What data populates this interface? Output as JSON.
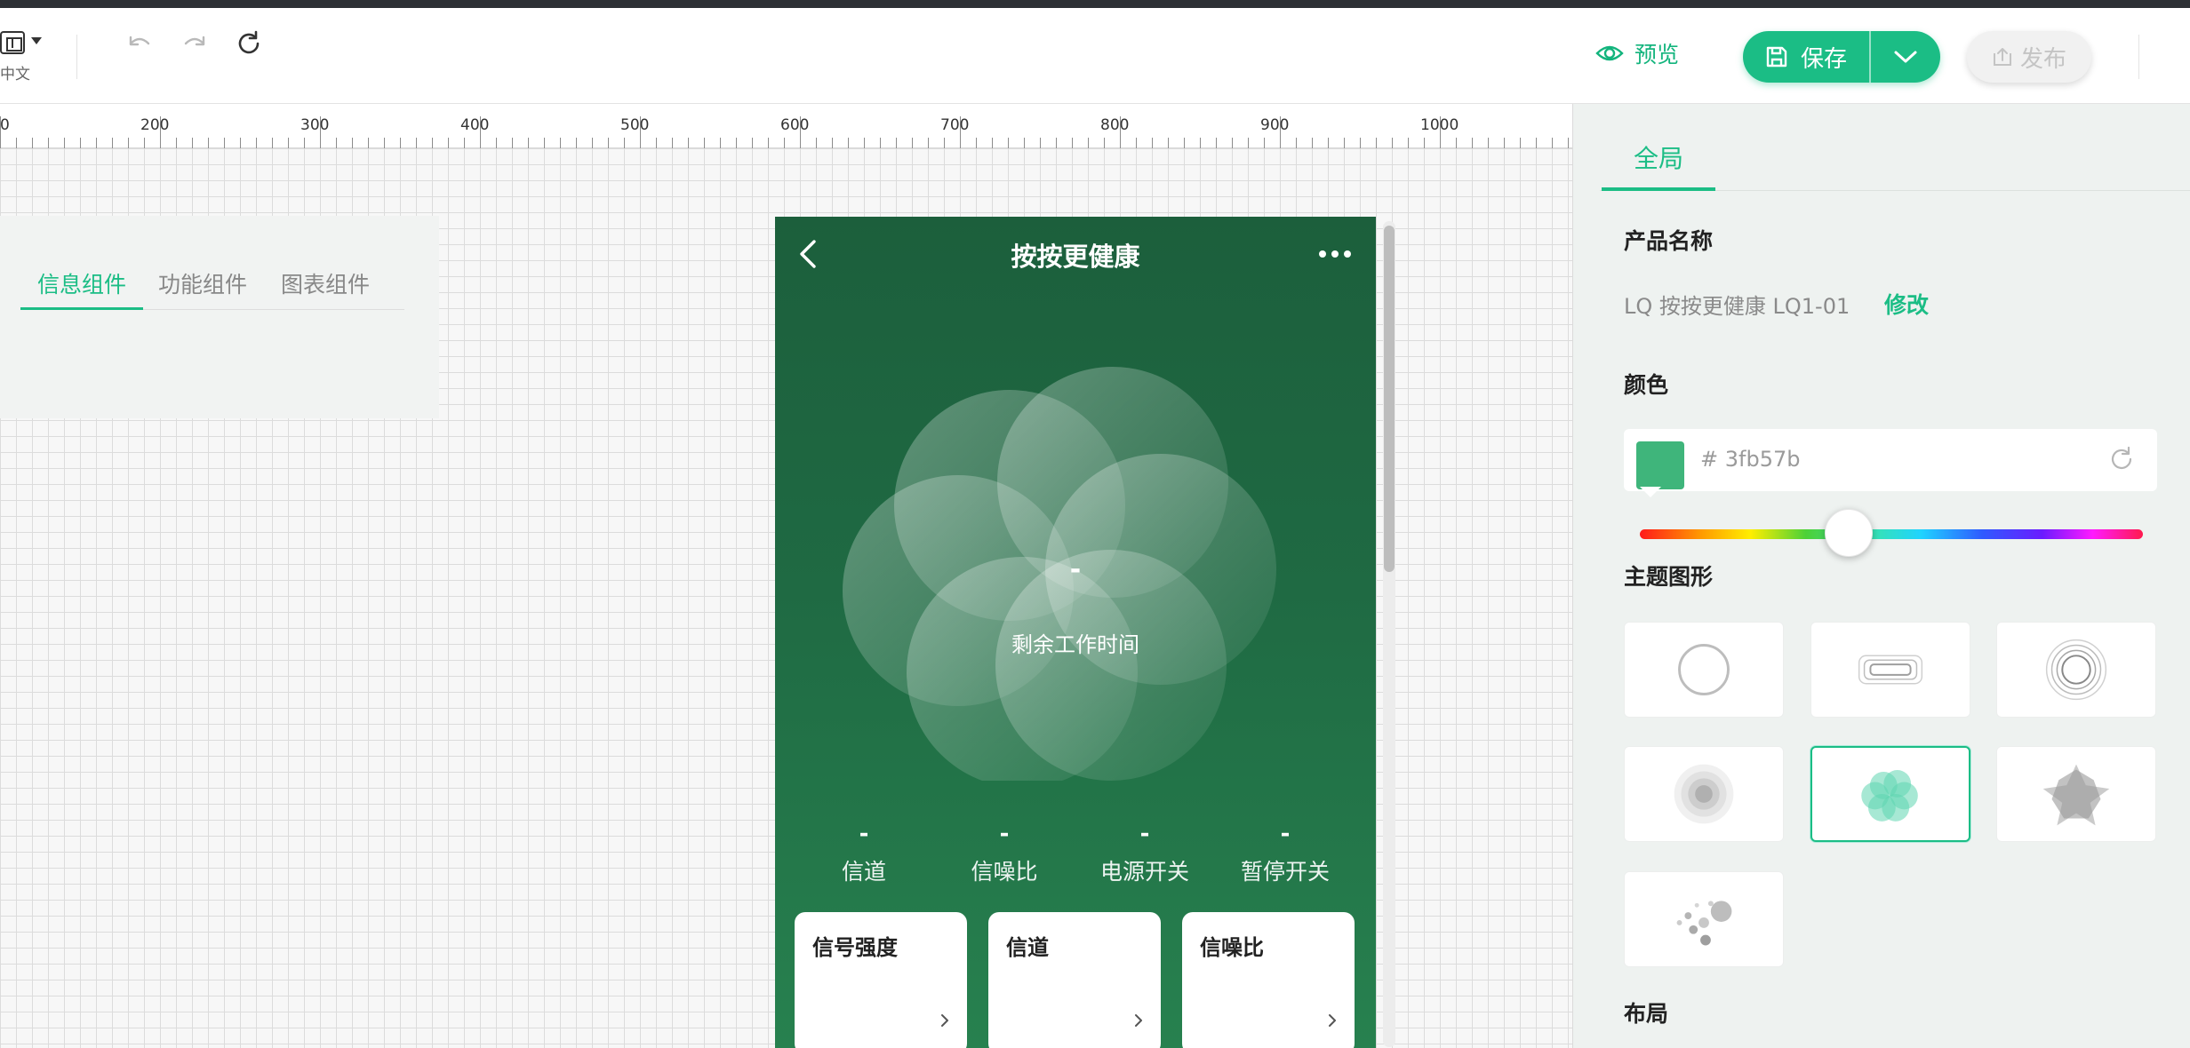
{
  "toolbar": {
    "language": "中文",
    "preview_label": "预览",
    "save_label": "保存",
    "publish_label": "发布"
  },
  "ruler": {
    "marks": [
      "0",
      "200",
      "300",
      "400",
      "500",
      "600",
      "700",
      "800",
      "900",
      "1000"
    ]
  },
  "component_panel": {
    "tabs": [
      {
        "label": "信息组件",
        "active": true
      },
      {
        "label": "功能组件",
        "active": false
      },
      {
        "label": "图表组件",
        "active": false
      }
    ]
  },
  "phone": {
    "title": "按按更健康",
    "remaining_time_value": "-",
    "remaining_time_label": "剩余工作时间",
    "stats": [
      {
        "value": "-",
        "label": "信道"
      },
      {
        "value": "-",
        "label": "信噪比"
      },
      {
        "value": "-",
        "label": "电源开关"
      },
      {
        "value": "-",
        "label": "暂停开关"
      }
    ],
    "cards": [
      {
        "title": "信号强度"
      },
      {
        "title": "信道"
      },
      {
        "title": "信噪比"
      }
    ]
  },
  "settings": {
    "tab": "全局",
    "product_name_title": "产品名称",
    "product_name": "LQ 按按更健康 LQ1-01",
    "edit_label": "修改",
    "color_title": "颜色",
    "color_hex_display": "# 3fb57b",
    "color_value": "#3fb57b",
    "theme_shape_title": "主题图形",
    "theme_shapes": [
      "circle",
      "rounded-rect",
      "concentric-rings",
      "radial-dots",
      "pinwheel",
      "star",
      "scatter-dots"
    ],
    "selected_shape": "pinwheel",
    "layout_title": "布局"
  },
  "colors": {
    "accent": "#1bbd85",
    "phone_bg": "#1f6a43"
  }
}
